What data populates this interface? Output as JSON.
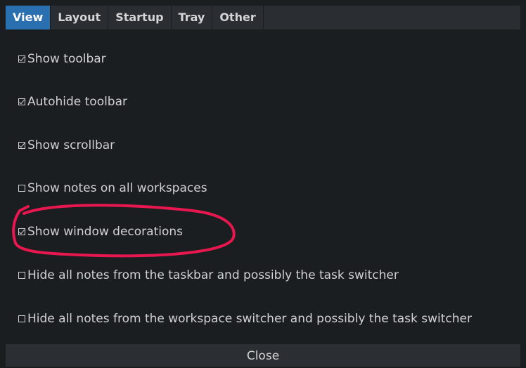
{
  "tabs": [
    {
      "label": "View",
      "active": true
    },
    {
      "label": "Layout",
      "active": false
    },
    {
      "label": "Startup",
      "active": false
    },
    {
      "label": "Tray",
      "active": false
    },
    {
      "label": "Other",
      "active": false
    }
  ],
  "options": [
    {
      "label": "Show toolbar",
      "checked": true
    },
    {
      "label": "Autohide toolbar",
      "checked": true
    },
    {
      "label": "Show scrollbar",
      "checked": true
    },
    {
      "label": "Show notes on all workspaces",
      "checked": false
    },
    {
      "label": "Show window decorations",
      "checked": true
    },
    {
      "label": "Hide all notes from the taskbar and possibly the task switcher",
      "checked": false
    },
    {
      "label": "Hide all notes from the workspace switcher and possibly the task switcher",
      "checked": false
    }
  ],
  "footer": {
    "close_label": "Close"
  },
  "colors": {
    "accent": "#2a6fb0",
    "annotation": "#e8174f",
    "background": "#1b1e20"
  }
}
